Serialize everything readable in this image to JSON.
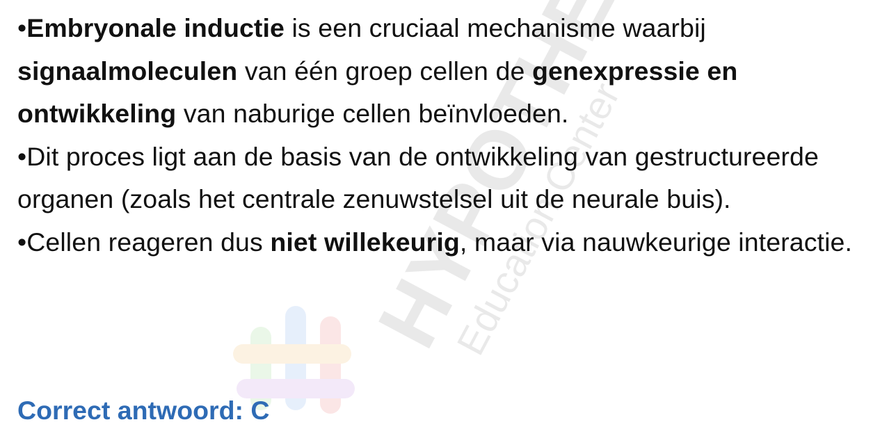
{
  "bullet_marker": "•",
  "bullets": [
    {
      "segments": [
        {
          "text": "Embryonale inductie",
          "bold": true
        },
        {
          "text": " is een cruciaal mechanisme waarbij ",
          "bold": false
        },
        {
          "text": "signaalmoleculen",
          "bold": true
        },
        {
          "text": " van één groep cellen de ",
          "bold": false
        },
        {
          "text": "genexpressie en ontwikkeling",
          "bold": true
        },
        {
          "text": " van naburige cellen beïnvloeden.",
          "bold": false
        }
      ]
    },
    {
      "segments": [
        {
          "text": "Dit proces ligt aan de basis van de ontwikkeling van gestructureerde organen (zoals het centrale zenuwstelsel uit de neurale buis).",
          "bold": false
        }
      ]
    },
    {
      "segments": [
        {
          "text": "Cellen reageren dus ",
          "bold": false
        },
        {
          "text": "niet willekeurig",
          "bold": true
        },
        {
          "text": ", maar via nauwkeurige interactie.",
          "bold": false
        }
      ]
    }
  ],
  "answer": {
    "text": "Correct antwoord: C",
    "color": "#2e6bb5"
  },
  "watermark": {
    "brand": "HYPOTHESE",
    "tagline": "Education Center",
    "logo_icon": "hashtag-logo-icon",
    "colors": [
      "#f2a7a7",
      "#a7c7f2",
      "#b7e3b0",
      "#f5d49a",
      "#d5b3ea"
    ]
  }
}
